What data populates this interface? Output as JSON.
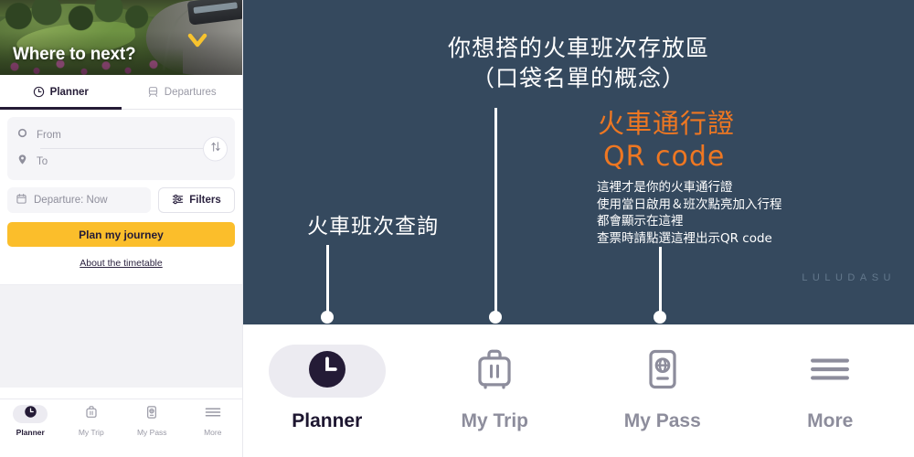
{
  "app": {
    "hero_title": "Where to next?",
    "chevron_icon": "chevron-down-icon"
  },
  "tabs": [
    {
      "label": "Planner",
      "icon": "clock-icon",
      "active": true
    },
    {
      "label": "Departures",
      "icon": "train-icon",
      "active": false
    }
  ],
  "form": {
    "from_placeholder": "From",
    "to_placeholder": "To",
    "from_icon": "circle-outline-icon",
    "to_icon": "map-pin-icon",
    "swap_icon": "swap-vertical-icon",
    "departure_label": "Departure: Now",
    "calendar_icon": "calendar-icon",
    "filters_label": "Filters",
    "filters_icon": "sliders-icon",
    "cta_label": "Plan my journey",
    "about_label": "About the timetable",
    "cta_color": "#fbbe2b"
  },
  "phone_nav": [
    {
      "label": "Planner",
      "icon": "clock-icon",
      "active": true
    },
    {
      "label": "My Trip",
      "icon": "suitcase-icon",
      "active": false
    },
    {
      "label": "My Pass",
      "icon": "passport-icon",
      "active": false
    },
    {
      "label": "More",
      "icon": "hamburger-menu-icon",
      "active": false
    }
  ],
  "annotation": {
    "panel_color": "#35495e",
    "accent_color": "#ee7722",
    "heading_line1": "你想搭的火車班次存放區",
    "heading_line2": "（口袋名單的概念）",
    "left_label": "火車班次查詢",
    "orange_line1": "火車通行證",
    "orange_line2": "QR code",
    "body_line1": "這裡才是你的火車通行證",
    "body_line2": "使用當日啟用＆班次點亮加入行程",
    "body_line3": "都會顯示在這裡",
    "body_line4": "查票時請點選這裡出示QR code",
    "watermark": "LULUDASU"
  },
  "big_nav": [
    {
      "label": "Planner",
      "icon": "clock-icon",
      "active": true
    },
    {
      "label": "My Trip",
      "icon": "suitcase-icon",
      "active": false
    },
    {
      "label": "My Pass",
      "icon": "passport-icon",
      "active": false
    },
    {
      "label": "More",
      "icon": "hamburger-menu-icon",
      "active": false
    }
  ]
}
